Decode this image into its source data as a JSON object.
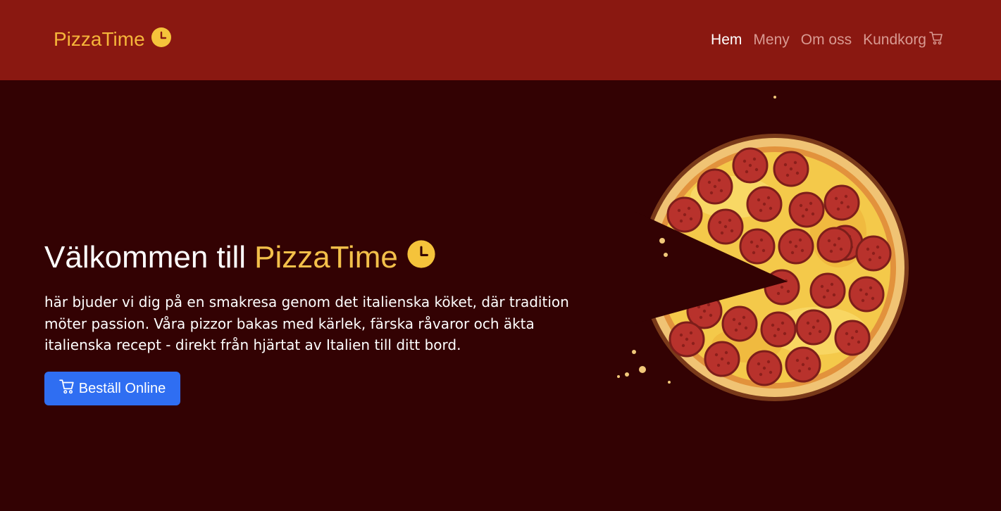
{
  "brand": {
    "name": "PizzaTime",
    "icon": "clock-icon"
  },
  "nav": {
    "items": [
      {
        "label": "Hem",
        "active": true
      },
      {
        "label": "Meny",
        "active": false
      },
      {
        "label": "Om oss",
        "active": false
      },
      {
        "label": "Kundkorg",
        "active": false,
        "icon": "cart-icon"
      }
    ]
  },
  "hero": {
    "title_prefix": "Välkommen till",
    "title_brand": "PizzaTime",
    "title_icon": "clock-icon",
    "text": "här bjuder vi dig på en smakresa genom det italienska köket, där tradition möter passion. Våra pizzor bakas med kärlek, färska råvaror och äkta italienska recept - direkt från hjärtat av Italien till ditt bord.",
    "button_label": "Beställ Online",
    "button_icon": "cart-icon",
    "image": "pizza-illustration"
  },
  "colors": {
    "header": "#8a1811",
    "background": "#330203",
    "accent": "#f3c04a",
    "button": "#2f6ef2",
    "nav_inactive": "#d99a92"
  }
}
